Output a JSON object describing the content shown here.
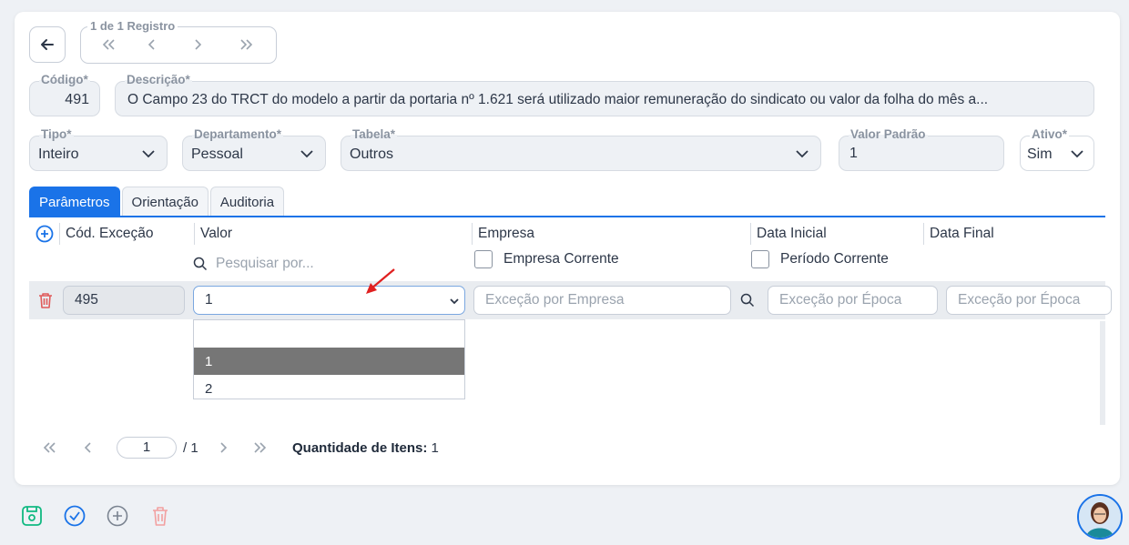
{
  "nav": {
    "record_label": "1 de 1 Registro",
    "icons": [
      "double-left-icon",
      "left-icon",
      "right-icon",
      "double-right-icon"
    ]
  },
  "form": {
    "codigo": {
      "label": "Código*",
      "value": "491"
    },
    "descricao": {
      "label": "Descrição*",
      "value": "O Campo 23 do TRCT do modelo a partir da portaria nº 1.621 será utilizado maior remuneração do sindicato ou valor da folha do mês a..."
    },
    "tipo": {
      "label": "Tipo*",
      "value": "Inteiro"
    },
    "departamento": {
      "label": "Departamento*",
      "value": "Pessoal"
    },
    "tabela": {
      "label": "Tabela*",
      "value": "Outros"
    },
    "valor_padrao": {
      "label": "Valor Padrão",
      "value": "1"
    },
    "ativo": {
      "label": "Ativo*",
      "value": "Sim"
    }
  },
  "tabs": [
    "Parâmetros",
    "Orientação",
    "Auditoria"
  ],
  "grid": {
    "headers": [
      "Cód. Exceção",
      "Valor",
      "Empresa",
      "Data Inicial",
      "Data Final"
    ],
    "search_placeholder": "Pesquisar por...",
    "empresa_corrente": "Empresa Corrente",
    "periodo_corrente": "Período Corrente",
    "row": {
      "codigo": "495",
      "valor": "1",
      "empresa_placeholder": "Exceção por Empresa",
      "data_inicial_placeholder": "Exceção por Época",
      "data_final_placeholder": "Exceção por Época"
    },
    "dropdown_options": [
      "",
      "1",
      "2"
    ],
    "dropdown_selected": "1"
  },
  "pager": {
    "page": "1",
    "total": "/ 1",
    "qty_label": "Quantidade de Itens:",
    "qty_value": "1"
  },
  "colors": {
    "accent": "#1a73e8",
    "save": "#10b981",
    "delete": "#f2a0a0",
    "arrow": "#e02020"
  }
}
